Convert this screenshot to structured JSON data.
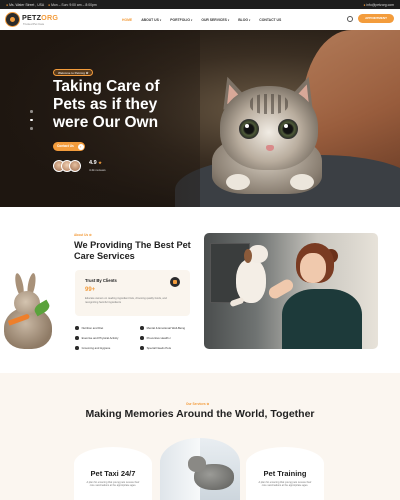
{
  "topbar": {
    "address": "Ms. Water Street , USA",
    "hours": "Mon – Sun: 9:00 am – 8:00pm",
    "email": "info@petzorg.com"
  },
  "brand": {
    "name_part1": "PETZ",
    "name_part2": "ORG",
    "tagline": "Trusted Pet Care",
    "accent_color": "#f39c3c"
  },
  "nav": {
    "items": [
      {
        "label": "HOME",
        "active": true,
        "dropdown": false
      },
      {
        "label": "ABOUT US",
        "active": false,
        "dropdown": true
      },
      {
        "label": "PORTFOLIO",
        "active": false,
        "dropdown": true
      },
      {
        "label": "OUR SERVICES",
        "active": false,
        "dropdown": true
      },
      {
        "label": "BLOG",
        "active": false,
        "dropdown": true
      },
      {
        "label": "CONTACT US",
        "active": false,
        "dropdown": false
      }
    ],
    "search_icon": "search-icon",
    "cta_label": "APPOINTMENT"
  },
  "hero": {
    "pill": "Welcome to Petzorg",
    "title": "Taking Care of Pets as if they were Our Own",
    "cta_label": "Contact Us",
    "rating": "4.9",
    "reviews": "4.2k reviews"
  },
  "about": {
    "pill": "About Us",
    "title": "We Providing The Best Pet Care Services",
    "trust": {
      "title": "Trust By Clients",
      "value": "99+",
      "description": "Educate owners on reading ingredient lists, choosing quality foods, and recognizing harmful ingredients"
    },
    "features": [
      "Nutrition and Diet",
      "Mental & Emotional Well-Being",
      "Exercise and Physical Activity",
      "Preventive Health c",
      "Grooming and Hygiene",
      "Special Needs Pets"
    ]
  },
  "memories": {
    "pill": "Our Services",
    "title": "Making Memories Around the World, Together",
    "cards": [
      {
        "title": "Pet Taxi 24/7",
        "description": "A plan for ensuring that young pets receive their core vaccinations at the appropriate ages."
      },
      {
        "title": "Pet Training",
        "description": "A plan for ensuring that young pets receive their core vaccinations at the appropriate ages."
      }
    ]
  }
}
